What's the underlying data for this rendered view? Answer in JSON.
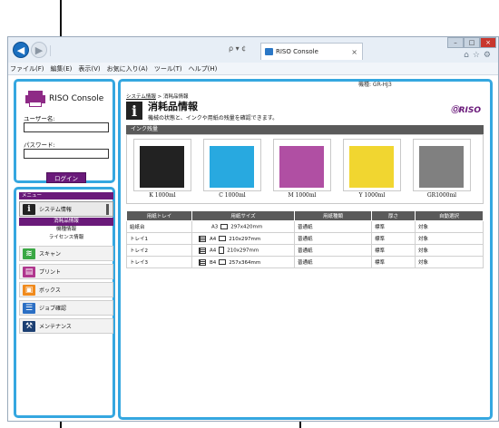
{
  "browser": {
    "tab_title": "RISO Console",
    "address_controls": "ρ ▾ ¢",
    "menu": [
      "ファイル(F)",
      "編集(E)",
      "表示(V)",
      "お気に入り(A)",
      "ツール(T)",
      "ヘルプ(H)"
    ]
  },
  "login": {
    "logo_text": "RISO Console",
    "username_label": "ユーザー名:",
    "password_label": "パスワード:",
    "login_button": "ログイン"
  },
  "menu": {
    "header": "メニュー",
    "system_info": "システム情報",
    "sub_items": [
      "消耗品情報",
      "機種情報",
      "ライセンス情報"
    ],
    "scan": "スキャン",
    "print": "プリント",
    "box": "ボックス",
    "job": "ジョブ確認",
    "maintenance": "メンテナンス"
  },
  "main": {
    "model_text": "機種: GR-HJ3",
    "breadcrumb_link": "システム情報",
    "breadcrumb_sep": " > ",
    "breadcrumb_current": "消耗品情報",
    "title": "消耗品情報",
    "description": "機械の状態と、インクや用紙の残量を確認できます。",
    "brand_logo": "ⓄRISO",
    "ink_section": "インク残量",
    "inks": [
      {
        "label": "K 1000ml",
        "color": "#222222"
      },
      {
        "label": "C 1000ml",
        "color": "#28a9e0"
      },
      {
        "label": "M 1000ml",
        "color": "#b04fa3"
      },
      {
        "label": "Y 1000ml",
        "color": "#f1d630"
      },
      {
        "label": "GR1000ml",
        "color": "#808080"
      }
    ],
    "paper_headers": [
      "用紙トレイ",
      "用紙サイズ",
      "用紙種類",
      "厚さ",
      "自動選択"
    ],
    "paper_rows": [
      {
        "tray": "給紙台",
        "size": "A3",
        "dim": "297x420mm",
        "type": "普通紙",
        "thick": "標準",
        "auto": "対象"
      },
      {
        "tray": "トレイ1",
        "size": "A4",
        "dim": "210x297mm",
        "type": "普通紙",
        "thick": "標準",
        "auto": "対象"
      },
      {
        "tray": "トレイ2",
        "size": "A4",
        "dim": "210x297mm",
        "type": "普通紙",
        "thick": "標準",
        "auto": "対象"
      },
      {
        "tray": "トレイ3",
        "size": "B4",
        "dim": "257x364mm",
        "type": "普通紙",
        "thick": "標準",
        "auto": "対象"
      }
    ]
  }
}
